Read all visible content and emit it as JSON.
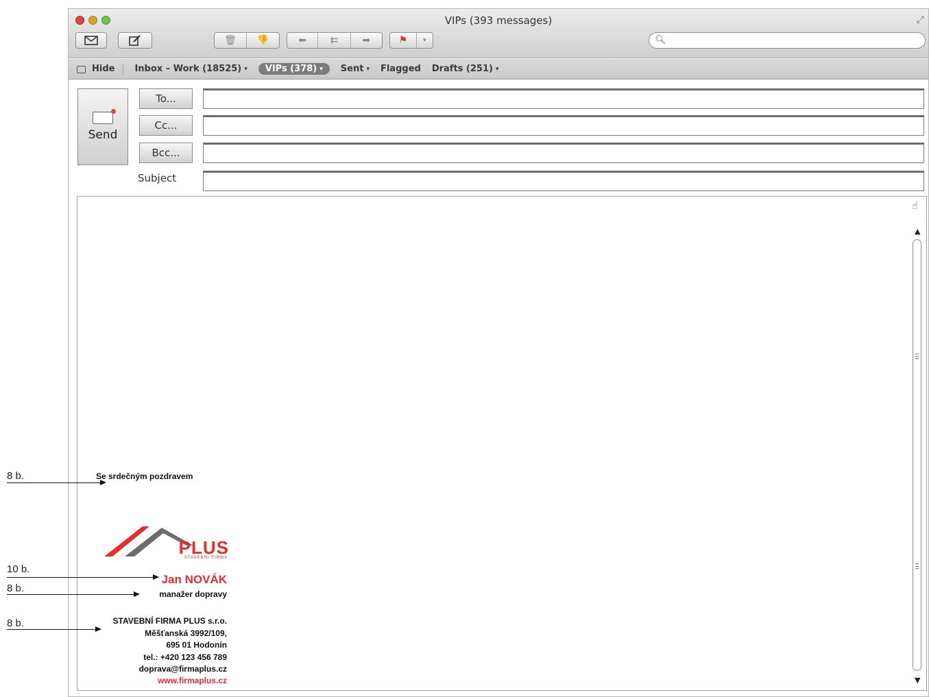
{
  "window": {
    "title": "VIPs (393 messages)"
  },
  "traffic_lights": {
    "close": "#e0443e",
    "minimize": "#dea123",
    "zoom": "#62c554"
  },
  "toolbar": {
    "get_mail_icon": "envelope-icon",
    "compose_icon": "compose-icon",
    "delete_icon": "trash-icon",
    "junk_icon": "thumbs-down-icon",
    "reply_icon": "reply-arrow-icon",
    "reply_all_icon": "reply-all-arrow-icon",
    "forward_icon": "forward-arrow-icon",
    "flag_icon": "flag-icon",
    "search": {
      "placeholder": ""
    }
  },
  "favorites": {
    "hide": "Hide",
    "items": [
      {
        "label": "Inbox – Work (18525)",
        "has_menu": true
      },
      {
        "label": "VIPs (378)",
        "has_menu": true,
        "selected": true
      },
      {
        "label": "Sent",
        "has_menu": true
      },
      {
        "label": "Flagged",
        "has_menu": false
      },
      {
        "label": "Drafts (251)",
        "has_menu": true
      }
    ],
    "caret": "▾"
  },
  "compose": {
    "send_label": "Send",
    "to_label": "To...",
    "cc_label": "Cc...",
    "bcc_label": "Bcc...",
    "subject_label": "Subject",
    "to_value": "",
    "cc_value": "",
    "bcc_value": "",
    "subject_value": ""
  },
  "signature": {
    "greeting": "Se srdečným pozdravem",
    "logo_text": "PLUS",
    "logo_subtitle": "STAVEBNÍ FIRMA",
    "name": "Jan NOVÁK",
    "role": "manažer dopravy",
    "company_lines": [
      "STAVEBNÍ FIRMA PLUS s.r.o.",
      "Měšťanská 3992/109,",
      "695 01 Hodonín",
      "tel.: +420 123 456 789",
      "doprava@firmaplus.cz"
    ],
    "web": "www.firmaplus.cz",
    "accent_color": "#ea2b2b"
  },
  "annotations": {
    "greeting_size": "8 b.",
    "name_size": "10 b.",
    "role_size": "8 b.",
    "company_size": "8 b."
  }
}
